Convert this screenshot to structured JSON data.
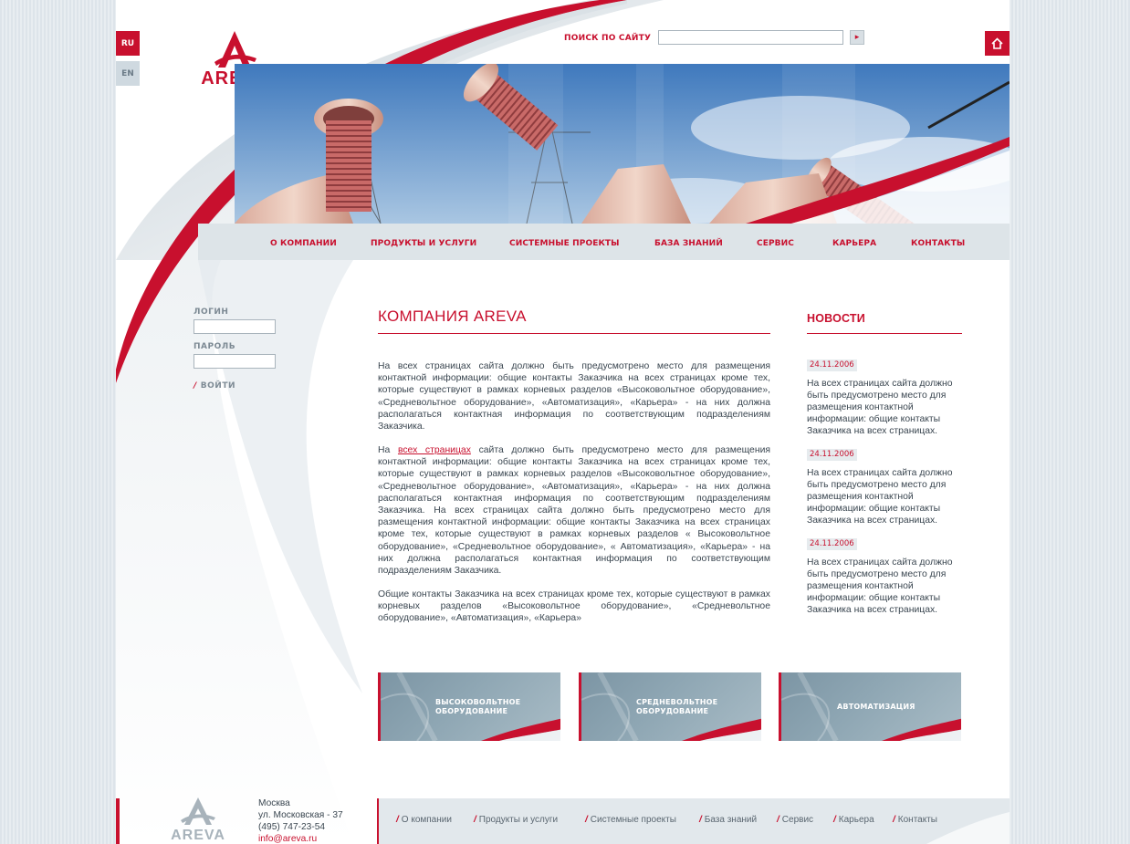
{
  "language": {
    "ru": "RU",
    "en": "EN"
  },
  "logo": {
    "text": "AREVA"
  },
  "search": {
    "label": "ПОИСК ПО САЙТУ",
    "placeholder": "",
    "button_icon": "arrow-right-icon"
  },
  "right_icons": [
    "home-icon",
    "email-icon",
    "sitemap-icon"
  ],
  "nav": {
    "items": [
      "О КОМПАНИИ",
      "ПРОДУКТЫ И УСЛУГИ",
      "СИСТЕМНЫЕ ПРОЕКТЫ",
      "БАЗА ЗНАНИЙ",
      "СЕРВИС",
      "КАРЬЕРА",
      "КОНТАКТЫ"
    ]
  },
  "login": {
    "login_label": "ЛОГИН",
    "password_label": "ПАРОЛЬ",
    "submit_label": "ВОЙТИ"
  },
  "main": {
    "title": "КОМПАНИЯ AREVA",
    "p1": "На всех страницах сайта должно быть предусмотрено место для размещения контактной информации: общие контакты Заказчика на всех страницах кроме тех, которые существуют в рамках корневых разделов «Высоковольтное оборудование», «Средневольтное оборудование», «Автоматизация», «Карьера» - на них должна располагаться контактная информация по соответствующим подразделениям Заказчика.",
    "p2_before": "На ",
    "p2_link": "всех страницах",
    "p2_after": " сайта должно быть предусмотрено место для размещения контактной информации: общие контакты Заказчика на всех страницах кроме тех, которые существуют в рамках корневых разделов «Высоковольтное оборудование», «Средневольтное оборудование», «Автоматизация», «Карьера» - на них должна располагаться контактная информация по соответствующим подразделениям Заказчика. На всех страницах сайта должно быть предусмотрено место для размещения контактной информации: общие контакты Заказчика на всех страницах кроме тех, которые существуют в рамках корневых разделов « Высоковольтное оборудование», «Средневольтное оборудование», « Автоматизация», «Карьера» - на них должна располагаться контактная информация по соответствующим подразделениям Заказчика.",
    "p3": "Общие контакты Заказчика на всех страницах кроме тех, которые существуют в рамках корневых разделов «Высоковольтное оборудование», «Средневольтное оборудование», «Автоматизация», «Карьера»"
  },
  "news": {
    "title": "НОВОСТИ",
    "items": [
      {
        "date": "24.11.2006",
        "text": "На всех страницах сайта должно быть предусмотрено место для размещения контактной информации: общие контакты Заказчика на всех страницах."
      },
      {
        "date": "24.11.2006",
        "text": "На всех страницах сайта должно быть предусмотрено место для размещения контактной информации: общие контакты Заказчика на всех страницах."
      },
      {
        "date": "24.11.2006",
        "text": "На всех страницах сайта должно быть предусмотрено место для размещения контактной информации: общие контакты Заказчика на всех страницах."
      }
    ]
  },
  "tiles": [
    {
      "label": "ВЫСОКОВОЛЬТНОЕ\nОБОРУДОВАНИЕ"
    },
    {
      "label": "СРЕДНЕВОЛЬТНОЕ\nОБОРУДОВАНИЕ"
    },
    {
      "label": "АВТОМАТИЗАЦИЯ"
    }
  ],
  "footer": {
    "logo_text": "AREVA",
    "city": "Москва",
    "street": "ул. Московская - 37",
    "phone": "(495) 747-23-54",
    "email": "info@areva.ru",
    "links": [
      "О компании",
      "Продукты и услуги",
      "Системные проекты",
      "База знаний",
      "Сервис",
      "Карьера",
      "Контакты"
    ]
  },
  "colors": {
    "brand_red": "#c8102e",
    "grey_blue": "#dde4e8",
    "text": "#3a4650"
  }
}
